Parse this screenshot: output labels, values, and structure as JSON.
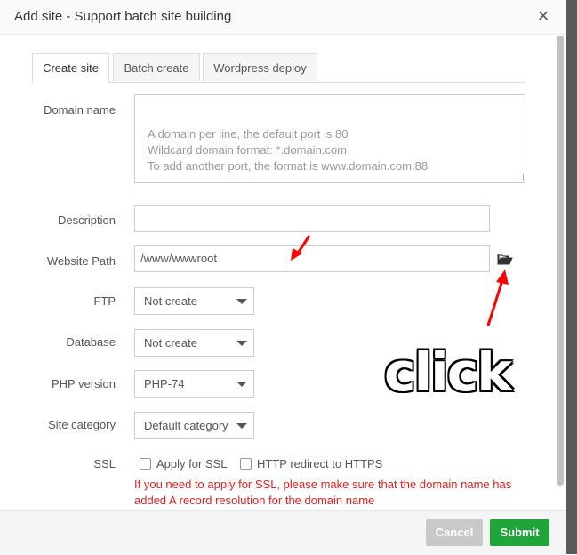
{
  "dialog": {
    "title": "Add site - Support batch site building",
    "close_glyph": "×"
  },
  "tabs": [
    {
      "label": "Create site",
      "active": true
    },
    {
      "label": "Batch create",
      "active": false
    },
    {
      "label": "Wordpress deploy",
      "active": false
    }
  ],
  "form": {
    "domain": {
      "label": "Domain name",
      "placeholder": "A domain per line, the default port is 80\nWildcard domain format: *.domain.com\nTo add another port, the format is www.domain.com:88"
    },
    "description": {
      "label": "Description",
      "value": ""
    },
    "path": {
      "label": "Website Path",
      "value": "/www/wwwroot",
      "icon": "folder-open-icon"
    },
    "ftp": {
      "label": "FTP",
      "value": "Not create"
    },
    "database": {
      "label": "Database",
      "value": "Not create"
    },
    "php": {
      "label": "PHP version",
      "value": "PHP-74"
    },
    "category": {
      "label": "Site category",
      "value": "Default category"
    },
    "ssl": {
      "label": "SSL",
      "apply_label": "Apply for SSL",
      "redirect_label": "HTTP redirect to HTTPS",
      "warning": "If you need to apply for SSL, please make sure that the domain name has added A record resolution for the domain name"
    }
  },
  "footer": {
    "cancel_label": "Cancel",
    "submit_label": "Submit"
  },
  "annotation": {
    "text": "click",
    "arrow_color": "#ff0000"
  },
  "colors": {
    "submit": "#20a53a",
    "cancel": "#c9c9c9",
    "warning": "#e02020"
  }
}
